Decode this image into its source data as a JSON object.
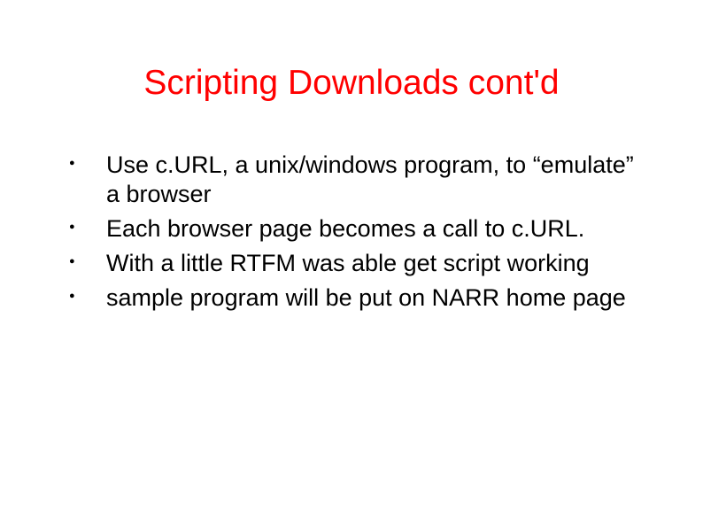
{
  "title": "Scripting Downloads cont'd",
  "bullets": [
    "Use c.URL, a unix/windows program, to “emulate” a browser",
    "Each browser page becomes a call to c.URL.",
    "With a little RTFM was able get script working",
    "sample program will be put on NARR home page"
  ]
}
